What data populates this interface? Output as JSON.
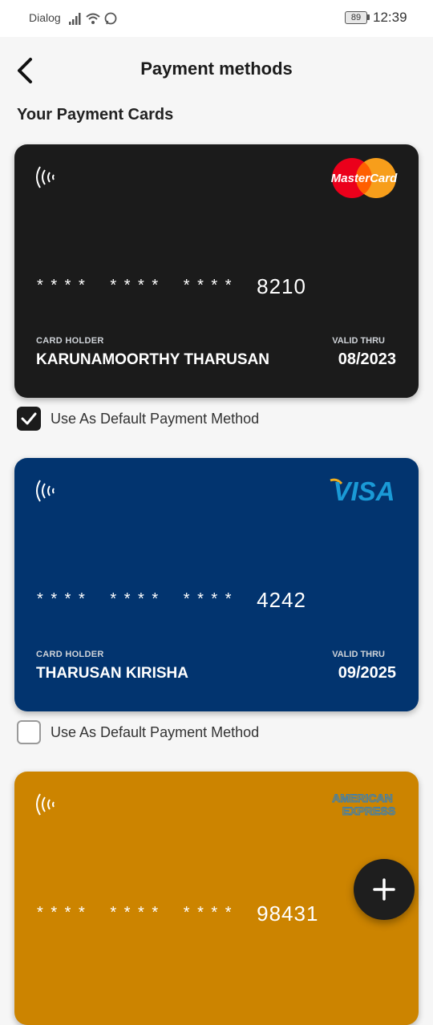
{
  "status_bar": {
    "carrier": "Dialog",
    "battery": "89",
    "time": "12:39"
  },
  "header": {
    "title": "Payment methods"
  },
  "section_title": "Your Payment Cards",
  "cards": [
    {
      "brand": "MasterCard",
      "background": "#1b1b1b",
      "masked_groups": [
        "* * * *",
        "* * * *",
        "* * * *"
      ],
      "last_digits": "8210",
      "holder_label": "CARD HOLDER",
      "holder_name": "KARUNAMOORTHY THARUSAN",
      "valid_label": "VALID THRU",
      "valid_thru": "08/2023",
      "default_label": "Use As Default Payment Method",
      "is_default": true
    },
    {
      "brand": "VISA",
      "background": "#02346f",
      "masked_groups": [
        "* * * *",
        "* * * *",
        "* * * *"
      ],
      "last_digits": "4242",
      "holder_label": "CARD HOLDER",
      "holder_name": "THARUSAN KIRISHA",
      "valid_label": "VALID THRU",
      "valid_thru": "09/2025",
      "default_label": "Use As Default Payment Method",
      "is_default": false
    },
    {
      "brand_line1": "AMERICAN",
      "brand_line2": "EXPRESS",
      "background": "#cc8400",
      "masked_groups": [
        "* * * *",
        "* * * *",
        "* * * *"
      ],
      "last_digits": "98431"
    }
  ],
  "icons": {
    "back": "arrow-left-icon",
    "contactless": "contactless-icon",
    "add": "plus-icon"
  },
  "colors": {
    "mastercard_red": "#eb001b",
    "mastercard_orange": "#f79e1b",
    "visa_blue": "#1a9ad6",
    "visa_gold": "#f2ae1c",
    "amex_blue": "#2f7fc1"
  }
}
